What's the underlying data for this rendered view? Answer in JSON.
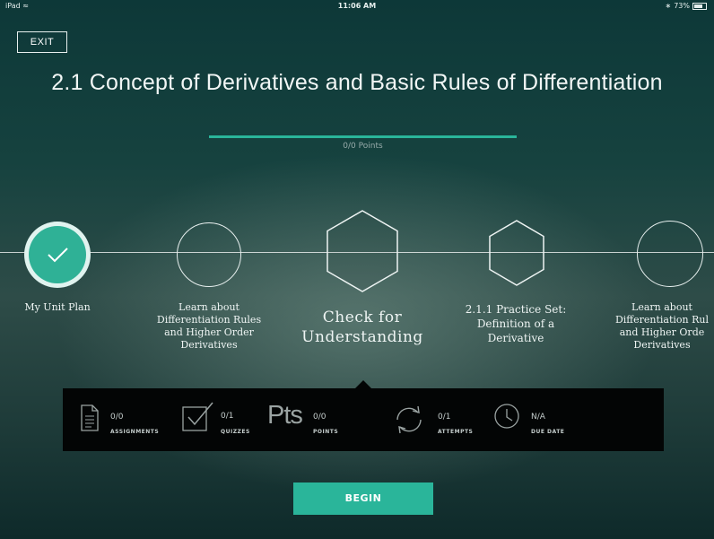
{
  "status_bar": {
    "device": "iPad",
    "time": "11:06 AM",
    "battery": "73%"
  },
  "header": {
    "exit_label": "EXIT",
    "title": "2.1 Concept of Derivatives and Basic Rules of Differentiation"
  },
  "progress": {
    "fraction": 1.0,
    "points_label": "0/0 Points",
    "color": "#2ab59a"
  },
  "timeline": {
    "nodes": [
      {
        "label": "My Unit Plan",
        "shape": "circle",
        "state": "complete"
      },
      {
        "label": "Learn about Differentiation Rules and Higher Order Derivatives",
        "shape": "circle",
        "state": "pending"
      },
      {
        "label": "Check for Understanding",
        "shape": "hexagon",
        "state": "current"
      },
      {
        "label": "2.1.1 Practice Set: Definition of a Derivative",
        "shape": "hexagon",
        "state": "pending"
      },
      {
        "label": "Learn about Differentiation Rules and Higher Order Derivatives",
        "shape": "circle",
        "state": "pending"
      }
    ],
    "label_lines": {
      "n0": [
        "My Unit Plan"
      ],
      "n1": [
        "Learn about",
        "Differentiation Rules",
        "and Higher Order",
        "Derivatives"
      ],
      "n2": [
        "Check for",
        "Understanding"
      ],
      "n3": [
        "2.1.1 Practice Set:",
        "Definition of a",
        "Derivative"
      ],
      "n4": [
        "Learn about",
        "Differentiation Rul",
        "and Higher Orde",
        "Derivatives"
      ]
    }
  },
  "stats": {
    "assignments": {
      "value": "0/0",
      "label": "ASSIGNMENTS",
      "icon": "document-icon"
    },
    "quizzes": {
      "value": "0/1",
      "label": "QUIZZES",
      "icon": "checkbox-icon"
    },
    "points": {
      "value": "0/0",
      "label": "POINTS",
      "icon_text": "Pts"
    },
    "attempts": {
      "value": "0/1",
      "label": "ATTEMPTS",
      "icon": "refresh-icon"
    },
    "due_date": {
      "value": "N/A",
      "label": "DUE DATE",
      "icon": "clock-icon"
    }
  },
  "actions": {
    "begin_label": "BEGIN"
  },
  "colors": {
    "accent": "#2ab59a",
    "info_bar": "#030505"
  }
}
